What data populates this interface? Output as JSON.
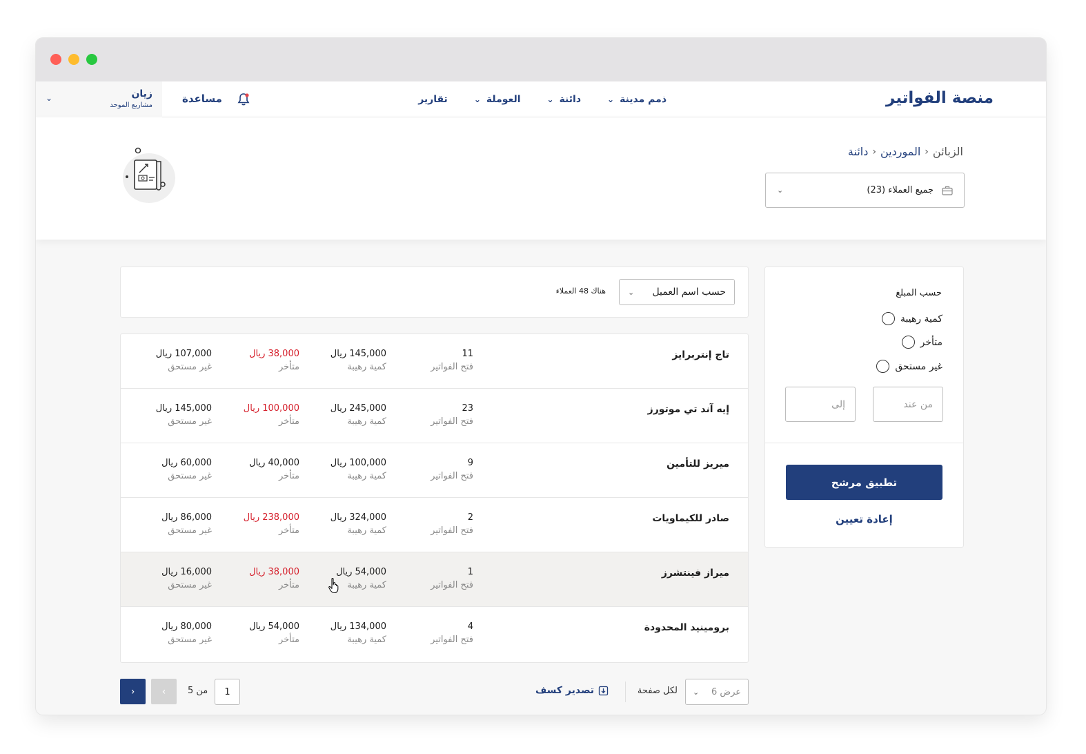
{
  "window": {
    "controls": [
      "close",
      "minimize",
      "maximize"
    ]
  },
  "navbar": {
    "brand": "منصة الفواتير",
    "menu": [
      {
        "label": "ذمم مدينة",
        "has_dropdown": true
      },
      {
        "label": "دائنة",
        "has_dropdown": true
      },
      {
        "label": "العوملة",
        "has_dropdown": true
      },
      {
        "label": "تقارير",
        "has_dropdown": false
      }
    ],
    "help": "مساعدة",
    "user": {
      "name": "زيان",
      "subtitle": "مشاريع الموحد"
    }
  },
  "header": {
    "breadcrumb": [
      "دائنة",
      "الموردين",
      "الزبائن"
    ],
    "customer_select": "جميع العملاء (23)"
  },
  "filter": {
    "title": "حسب المبلغ",
    "options": [
      "كمية رهيبة",
      "متأخر",
      "غير مستحق"
    ],
    "from_placeholder": "من عند",
    "to_placeholder": "إلى",
    "apply_label": "تطبيق مرشح",
    "reset_label": "إعادة تعيين"
  },
  "sort": {
    "selected": "حسب اسم العميل",
    "count_text": "هناك 48 العملاء"
  },
  "table": {
    "labels": {
      "open_invoices": "فتح الفواتير",
      "total": "كمية رهيبة",
      "overdue": "متأخر",
      "not_due": "غير مستحق"
    },
    "rows": [
      {
        "name": "تاج إنتربرايز",
        "open_invoices": "11",
        "total": "145,000 ريال",
        "overdue": "38,000 ريال",
        "overdue_red": true,
        "not_due": "107,000 ريال"
      },
      {
        "name": "إيه آند تي موتورز",
        "open_invoices": "23",
        "total": "245,000 ريال",
        "overdue": "100,000 ريال",
        "overdue_red": true,
        "not_due": "145,000 ريال"
      },
      {
        "name": "ميريز للتأمين",
        "open_invoices": "9",
        "total": "100,000 ريال",
        "overdue": "40,000 ريال",
        "overdue_red": false,
        "not_due": "60,000 ريال"
      },
      {
        "name": "صادر للكيماويات",
        "open_invoices": "2",
        "total": "324,000 ريال",
        "overdue": "238,000 ريال",
        "overdue_red": true,
        "not_due": "86,000 ريال"
      },
      {
        "name": "ميراز فينتشرز",
        "open_invoices": "1",
        "total": "54,000 ريال",
        "overdue": "38,000 ريال",
        "overdue_red": true,
        "not_due": "16,000 ريال"
      },
      {
        "name": "برومينيد المحدودة",
        "open_invoices": "4",
        "total": "134,000 ريال",
        "overdue": "54,000 ريال",
        "overdue_red": false,
        "not_due": "80,000 ريال"
      }
    ]
  },
  "footer": {
    "per_page_select": "عرض 6",
    "per_page_label": "لكل صفحة",
    "export_label": "تصدير كسف",
    "current_page": "1",
    "of_text": "من 5",
    "prev_icon": "‹",
    "next_icon": "›"
  },
  "colors": {
    "primary": "#223f7c",
    "overdue": "#d51f2b",
    "muted": "#8a8a8a"
  }
}
